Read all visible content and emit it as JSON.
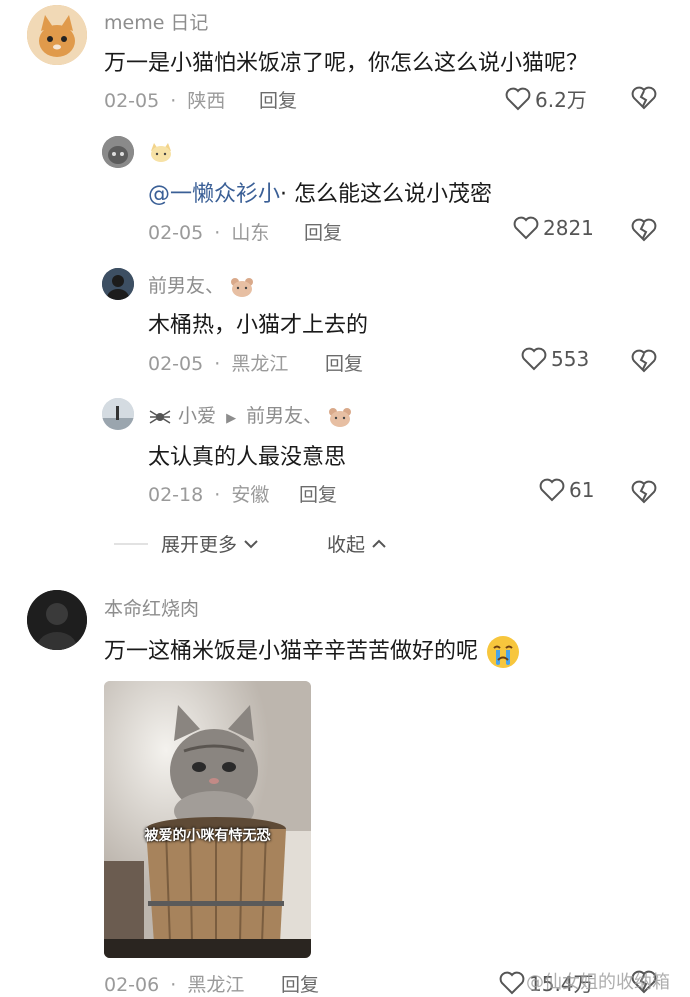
{
  "comments": [
    {
      "name": "meme 日记",
      "text": "万一是小猫怕米饭凉了呢，你怎么这么说小猫呢？",
      "date": "02-05",
      "location": "陕西",
      "reply_label": "回复",
      "likes": "6.2万"
    },
    {
      "name": "",
      "mention": "@一懒众衫小",
      "text": "· 怎么能这么说小茂密",
      "date": "02-05",
      "location": "山东",
      "reply_label": "回复",
      "likes": "2821"
    },
    {
      "name": "前男友、",
      "text": "木桶热，小猫才上去的",
      "date": "02-05",
      "location": "黑龙江",
      "reply_label": "回复",
      "likes": "553"
    },
    {
      "name": "小爱",
      "reply_to": "前男友、",
      "text": "太认真的人最没意思",
      "date": "02-18",
      "location": "安徽",
      "reply_label": "回复",
      "likes": "61"
    },
    {
      "name": "本命红烧肉",
      "text": "万一这桶米饭是小猫辛辛苦苦做好的呢",
      "image_caption": "被爱的小咪有恃无恐",
      "date": "02-06",
      "location": "黑龙江",
      "reply_label": "回复",
      "likes": "15.4万"
    }
  ],
  "thread_controls": {
    "expand_more": "展开更多",
    "collapse": "收起"
  },
  "watermark": "@仙女姐的收纳箱",
  "separator": "·"
}
